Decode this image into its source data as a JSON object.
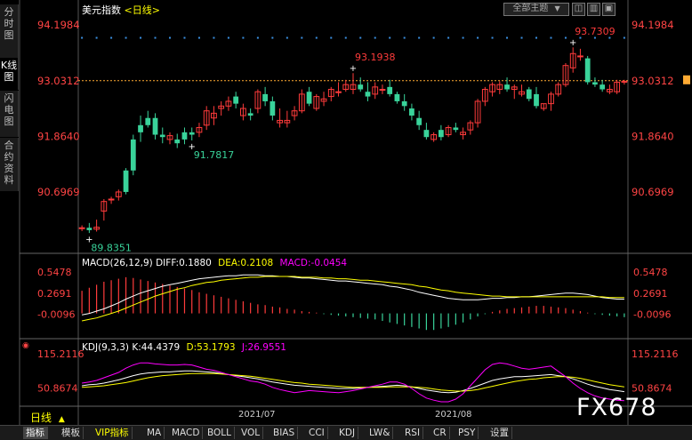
{
  "sidebar": [
    {
      "label": "分时图",
      "active": false
    },
    {
      "label": "K线图",
      "active": true
    },
    {
      "label": "闪电图",
      "active": false
    },
    {
      "label": "合约资料",
      "active": false
    }
  ],
  "toolbar": {
    "theme_select": "全部主题",
    "theme_arrow": "▼",
    "btn1": "◫",
    "btn2": "▥",
    "btn3": "▣"
  },
  "header": {
    "title": "美元指数",
    "period": "<日线>"
  },
  "main_axis": {
    "ticks": [
      "94.1984",
      "93.0312",
      "91.8640",
      "90.6969"
    ],
    "current": "93.0312"
  },
  "annotations": {
    "high1": "93.1938",
    "high2": "93.7309",
    "low1": "89.8351",
    "low2": "91.7817"
  },
  "macd": {
    "label": "MACD(26,12,9)",
    "diff": "DIFF:0.1880",
    "dea": "DEA:0.2108",
    "macd": "MACD:-0.0454",
    "ticks": [
      "0.5478",
      "0.2691",
      "-0.0096"
    ]
  },
  "kdj": {
    "label": "KDJ(9,3,3)",
    "k": "K:44.4379",
    "d": "D:53.1793",
    "j": "J:26.9551",
    "ticks": [
      "115.2116",
      "50.8674"
    ]
  },
  "dates": {
    "d1": "2021/07",
    "d2": "2021/08"
  },
  "period_label": "日线",
  "period_arrow": "▲",
  "watermark": "FX678",
  "bottom_tabs": [
    "指标",
    "模板",
    "VIP指标",
    "MA",
    "MACD",
    "BOLL",
    "VOL",
    "BIAS",
    "CCI",
    "KDJ",
    "LW&",
    "RSI",
    "CR",
    "PSY",
    "设置"
  ],
  "colors": {
    "up": "#ff3b3b",
    "down": "#39d39a",
    "yellow": "#ffff00",
    "magenta": "#ff00ff",
    "white": "#ffffff",
    "axis": "#ff4444",
    "dots": "#3a8fe0"
  },
  "chart_data": {
    "type": "candlestick",
    "price_ohlc": [
      [
        89.93,
        90.0,
        89.88,
        89.95
      ],
      [
        89.95,
        90.05,
        89.84,
        89.9
      ],
      [
        89.92,
        90.12,
        89.87,
        89.96
      ],
      [
        90.3,
        90.55,
        90.1,
        90.5
      ],
      [
        90.55,
        90.6,
        90.45,
        90.55
      ],
      [
        90.6,
        90.75,
        90.52,
        90.7
      ],
      [
        91.15,
        91.2,
        90.65,
        90.7
      ],
      [
        91.8,
        91.9,
        91.05,
        91.15
      ],
      [
        92.1,
        92.3,
        91.75,
        91.95
      ],
      [
        92.25,
        92.4,
        92.05,
        92.1
      ],
      [
        92.25,
        92.35,
        91.8,
        91.9
      ],
      [
        91.9,
        92.05,
        91.72,
        91.85
      ],
      [
        91.8,
        91.95,
        91.7,
        91.88
      ],
      [
        91.8,
        91.92,
        91.62,
        91.72
      ],
      [
        91.95,
        92.05,
        91.7,
        91.8
      ],
      [
        91.95,
        92.05,
        91.78,
        91.9
      ],
      [
        91.95,
        92.15,
        91.85,
        92.05
      ],
      [
        92.1,
        92.5,
        92.0,
        92.4
      ],
      [
        92.25,
        92.5,
        92.1,
        92.35
      ],
      [
        92.45,
        92.6,
        92.3,
        92.5
      ],
      [
        92.5,
        92.7,
        92.4,
        92.6
      ],
      [
        92.7,
        92.8,
        92.45,
        92.55
      ],
      [
        92.3,
        92.55,
        92.2,
        92.45
      ],
      [
        92.35,
        92.45,
        92.2,
        92.3
      ],
      [
        92.45,
        92.85,
        92.35,
        92.8
      ],
      [
        92.75,
        92.9,
        92.5,
        92.6
      ],
      [
        92.6,
        92.7,
        92.2,
        92.3
      ],
      [
        92.15,
        92.45,
        92.05,
        92.2
      ],
      [
        92.15,
        92.4,
        92.05,
        92.2
      ],
      [
        92.3,
        92.5,
        92.2,
        92.4
      ],
      [
        92.4,
        92.85,
        92.35,
        92.75
      ],
      [
        92.8,
        92.9,
        92.5,
        92.55
      ],
      [
        92.45,
        92.75,
        92.4,
        92.7
      ],
      [
        92.6,
        92.8,
        92.5,
        92.65
      ],
      [
        92.7,
        92.9,
        92.6,
        92.85
      ],
      [
        92.8,
        93.0,
        92.7,
        92.8
      ],
      [
        92.85,
        93.05,
        92.8,
        92.95
      ],
      [
        92.85,
        93.19,
        92.75,
        92.95
      ],
      [
        92.95,
        93.1,
        92.8,
        92.85
      ],
      [
        92.8,
        93.0,
        92.6,
        92.7
      ],
      [
        92.75,
        93.0,
        92.65,
        92.9
      ],
      [
        92.85,
        92.95,
        92.75,
        92.85
      ],
      [
        92.9,
        93.05,
        92.7,
        92.75
      ],
      [
        92.75,
        92.8,
        92.55,
        92.6
      ],
      [
        92.6,
        92.75,
        92.4,
        92.5
      ],
      [
        92.45,
        92.55,
        92.2,
        92.3
      ],
      [
        92.25,
        92.4,
        92.0,
        92.1
      ],
      [
        92.0,
        92.15,
        91.8,
        91.85
      ],
      [
        91.8,
        91.95,
        91.75,
        91.9
      ],
      [
        92.0,
        92.1,
        91.78,
        91.85
      ],
      [
        91.9,
        92.1,
        91.85,
        92.05
      ],
      [
        92.05,
        92.15,
        91.95,
        92.0
      ],
      [
        91.9,
        92.05,
        91.8,
        91.95
      ],
      [
        92.0,
        92.2,
        91.9,
        92.15
      ],
      [
        92.15,
        92.65,
        92.05,
        92.6
      ],
      [
        92.6,
        92.9,
        92.5,
        92.85
      ],
      [
        92.8,
        93.0,
        92.7,
        92.95
      ],
      [
        92.85,
        93.02,
        92.75,
        92.95
      ],
      [
        92.95,
        93.1,
        92.8,
        92.85
      ],
      [
        92.85,
        92.95,
        92.65,
        92.9
      ],
      [
        92.75,
        92.95,
        92.7,
        92.8
      ],
      [
        92.85,
        92.9,
        92.6,
        92.65
      ],
      [
        92.75,
        92.9,
        92.45,
        92.5
      ],
      [
        92.45,
        92.55,
        92.4,
        92.55
      ],
      [
        92.55,
        92.8,
        92.4,
        92.75
      ],
      [
        92.75,
        93.0,
        92.7,
        92.95
      ],
      [
        92.95,
        93.4,
        92.9,
        93.35
      ],
      [
        93.3,
        93.73,
        93.2,
        93.6
      ],
      [
        93.55,
        93.7,
        93.45,
        93.55
      ],
      [
        93.5,
        93.55,
        92.95,
        93.0
      ],
      [
        93.0,
        93.1,
        92.9,
        92.95
      ],
      [
        92.95,
        93.05,
        92.8,
        92.85
      ],
      [
        92.8,
        92.95,
        92.75,
        92.85
      ],
      [
        92.8,
        93.05,
        92.75,
        93.0
      ],
      [
        93.0,
        93.05,
        92.95,
        93.02
      ]
    ],
    "macd_hist": [
      0.3,
      0.34,
      0.38,
      0.42,
      0.44,
      0.46,
      0.48,
      0.47,
      0.45,
      0.43,
      0.41,
      0.39,
      0.37,
      0.35,
      0.33,
      0.31,
      0.28,
      0.26,
      0.24,
      0.22,
      0.2,
      0.18,
      0.16,
      0.14,
      0.12,
      0.11,
      0.09,
      0.08,
      0.06,
      0.05,
      0.03,
      0.02,
      0.01,
      -0.01,
      -0.02,
      -0.03,
      -0.04,
      -0.05,
      -0.06,
      -0.07,
      -0.08,
      -0.1,
      -0.12,
      -0.14,
      -0.16,
      -0.18,
      -0.2,
      -0.22,
      -0.22,
      -0.2,
      -0.18,
      -0.15,
      -0.12,
      -0.08,
      -0.04,
      -0.01,
      0.02,
      0.04,
      0.06,
      0.07,
      0.08,
      0.09,
      0.1,
      0.1,
      0.09,
      0.08,
      0.07,
      0.05,
      0.03,
      0.01,
      -0.01,
      -0.02,
      -0.03,
      -0.04,
      -0.05
    ],
    "macd_diff": [
      -0.02,
      0.0,
      0.03,
      0.06,
      0.1,
      0.14,
      0.19,
      0.23,
      0.27,
      0.3,
      0.33,
      0.36,
      0.38,
      0.4,
      0.42,
      0.44,
      0.46,
      0.47,
      0.48,
      0.49,
      0.5,
      0.5,
      0.51,
      0.51,
      0.51,
      0.5,
      0.5,
      0.49,
      0.49,
      0.48,
      0.47,
      0.47,
      0.46,
      0.45,
      0.44,
      0.43,
      0.43,
      0.42,
      0.41,
      0.4,
      0.39,
      0.38,
      0.36,
      0.35,
      0.33,
      0.31,
      0.28,
      0.26,
      0.24,
      0.22,
      0.2,
      0.19,
      0.18,
      0.18,
      0.18,
      0.19,
      0.2,
      0.2,
      0.21,
      0.21,
      0.22,
      0.22,
      0.23,
      0.24,
      0.25,
      0.26,
      0.27,
      0.27,
      0.26,
      0.25,
      0.23,
      0.21,
      0.2,
      0.19,
      0.19
    ],
    "macd_dea": [
      -0.1,
      -0.08,
      -0.06,
      -0.03,
      0.0,
      0.03,
      0.07,
      0.11,
      0.15,
      0.19,
      0.23,
      0.26,
      0.29,
      0.32,
      0.34,
      0.37,
      0.39,
      0.41,
      0.42,
      0.44,
      0.45,
      0.46,
      0.47,
      0.48,
      0.48,
      0.49,
      0.49,
      0.49,
      0.49,
      0.49,
      0.48,
      0.48,
      0.48,
      0.47,
      0.47,
      0.46,
      0.46,
      0.45,
      0.44,
      0.44,
      0.43,
      0.42,
      0.41,
      0.4,
      0.39,
      0.38,
      0.36,
      0.35,
      0.33,
      0.31,
      0.3,
      0.28,
      0.27,
      0.26,
      0.25,
      0.24,
      0.23,
      0.23,
      0.22,
      0.22,
      0.22,
      0.22,
      0.22,
      0.22,
      0.22,
      0.22,
      0.22,
      0.22,
      0.22,
      0.22,
      0.22,
      0.22,
      0.21,
      0.21,
      0.21
    ],
    "kdj_k": [
      55,
      57,
      58,
      60,
      63,
      66,
      70,
      74,
      77,
      79,
      80,
      81,
      81,
      82,
      83,
      83,
      82,
      81,
      80,
      78,
      76,
      74,
      72,
      70,
      68,
      65,
      62,
      60,
      58,
      56,
      55,
      54,
      53,
      52,
      51,
      50,
      50,
      50,
      51,
      52,
      53,
      54,
      55,
      56,
      55,
      53,
      50,
      47,
      45,
      43,
      42,
      43,
      46,
      50,
      55,
      60,
      65,
      68,
      70,
      72,
      72,
      73,
      74,
      75,
      76,
      74,
      72,
      68,
      63,
      58,
      54,
      51,
      48,
      46,
      44
    ],
    "kdj_d": [
      52,
      53,
      54,
      55,
      57,
      59,
      61,
      64,
      67,
      70,
      72,
      74,
      75,
      76,
      77,
      78,
      78,
      78,
      78,
      77,
      76,
      75,
      74,
      73,
      71,
      69,
      67,
      65,
      63,
      61,
      60,
      58,
      57,
      56,
      55,
      54,
      53,
      52,
      52,
      52,
      52,
      52,
      53,
      53,
      53,
      53,
      52,
      51,
      49,
      47,
      46,
      45,
      45,
      46,
      48,
      51,
      54,
      57,
      60,
      63,
      65,
      67,
      68,
      70,
      71,
      72,
      72,
      71,
      69,
      66,
      63,
      60,
      57,
      55,
      53
    ],
    "kdj_j": [
      60,
      62,
      65,
      70,
      75,
      80,
      88,
      94,
      98,
      98,
      96,
      95,
      94,
      94,
      95,
      94,
      90,
      86,
      84,
      80,
      76,
      72,
      68,
      64,
      62,
      58,
      52,
      48,
      45,
      42,
      44,
      46,
      45,
      44,
      43,
      42,
      44,
      46,
      49,
      52,
      55,
      58,
      62,
      62,
      58,
      50,
      40,
      32,
      28,
      25,
      25,
      30,
      40,
      55,
      70,
      85,
      95,
      98,
      96,
      92,
      88,
      86,
      88,
      90,
      92,
      82,
      72,
      60,
      50,
      42,
      36,
      32,
      30,
      28,
      27
    ],
    "xlim": [
      0,
      75
    ]
  }
}
